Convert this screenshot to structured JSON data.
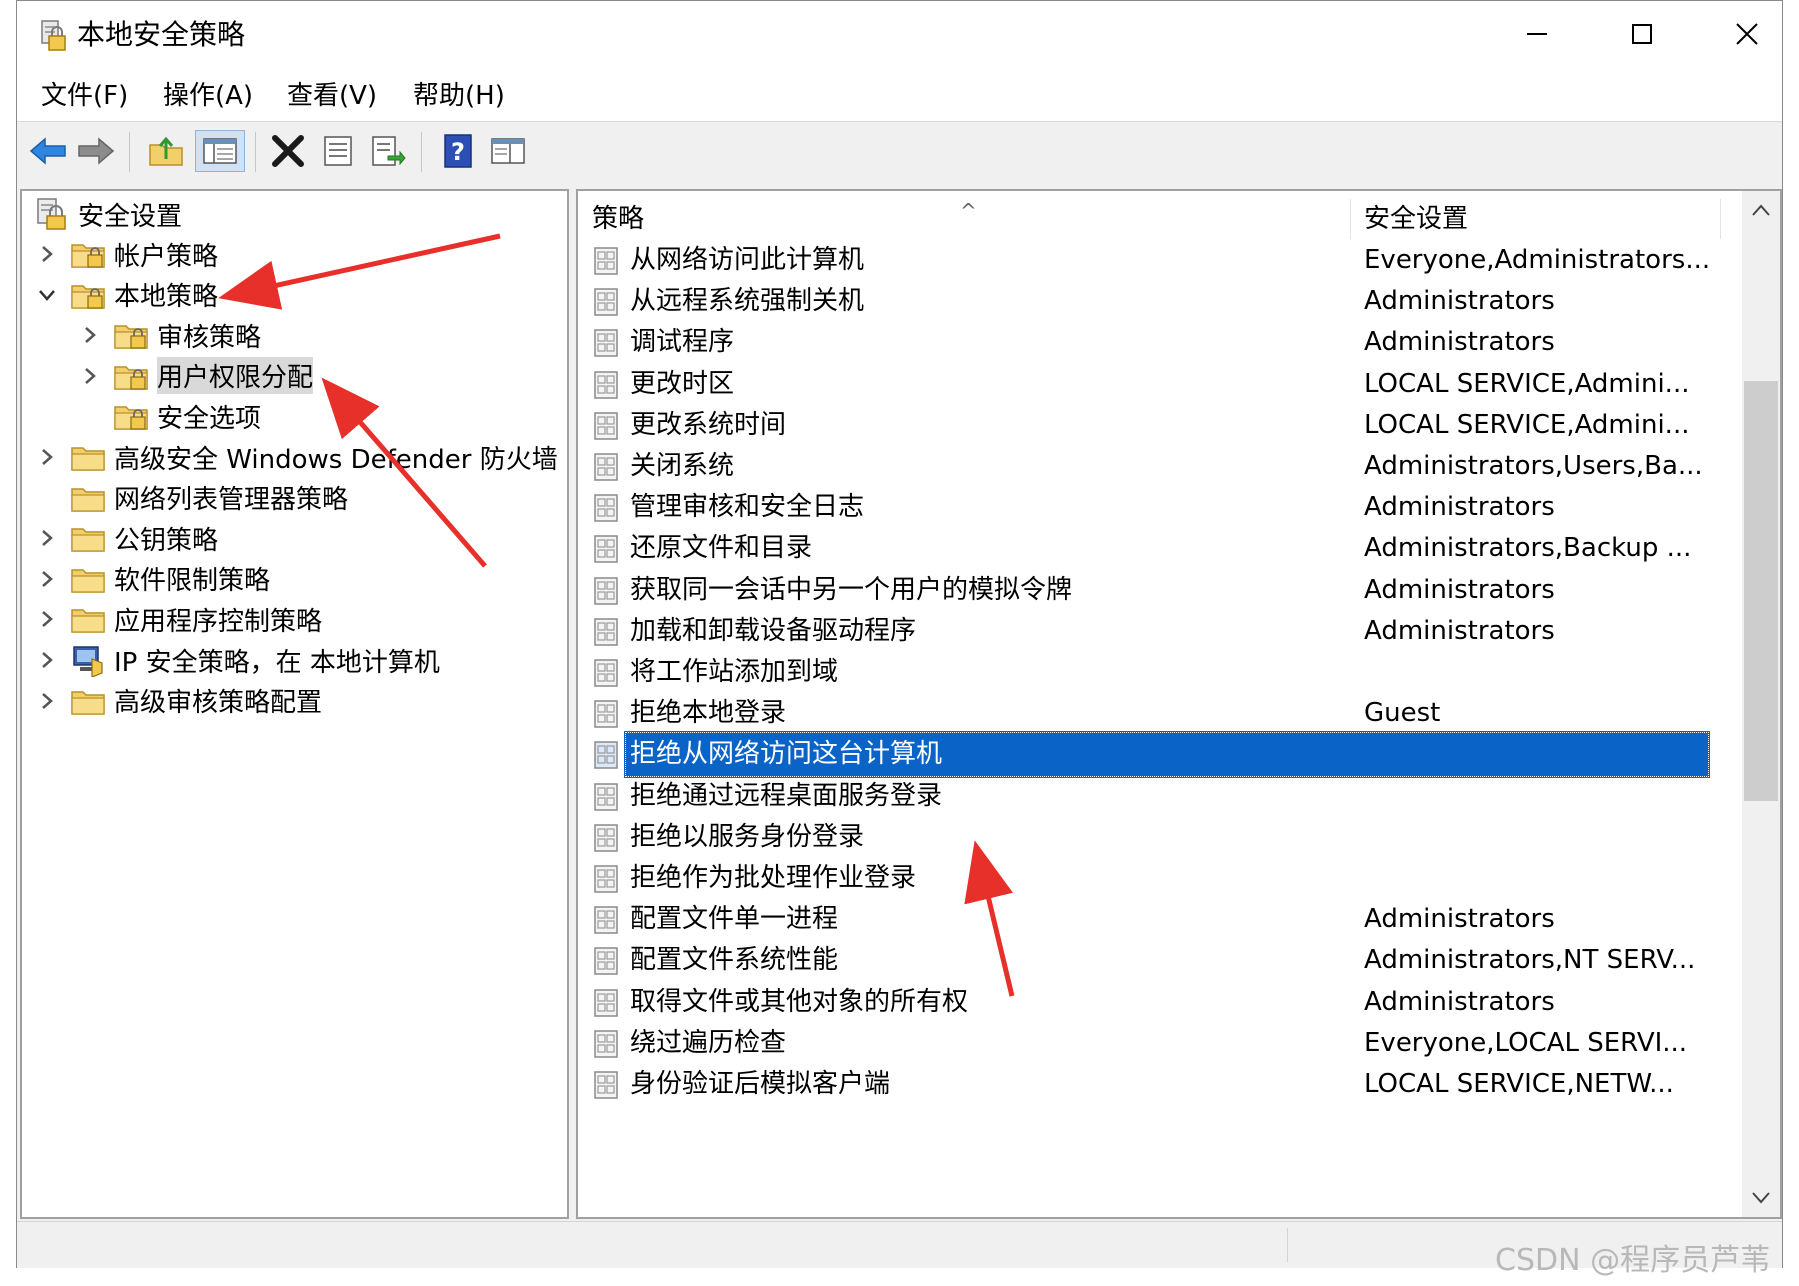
{
  "window": {
    "title": "本地安全策略",
    "icon": "security-policy-icon",
    "controls": [
      "minimize-icon",
      "maximize-icon",
      "close-icon"
    ]
  },
  "menu": {
    "file": "文件(F)",
    "action": "操作(A)",
    "view": "查看(V)",
    "help": "帮助(H)"
  },
  "toolbar": {
    "buttons": [
      "back-arrow-icon",
      "forward-arrow-icon",
      "up-folder-icon",
      "show-hide-tree-icon",
      "delete-icon",
      "properties-icon",
      "export-list-icon",
      "help-icon",
      "console-view-icon"
    ],
    "pressed": "show-hide-tree-icon"
  },
  "tree": {
    "root": "安全设置",
    "items": [
      {
        "label": "帐户策略",
        "level": 1,
        "expander": "collapsed"
      },
      {
        "label": "本地策略",
        "level": 1,
        "expander": "expanded"
      },
      {
        "label": "审核策略",
        "level": 2,
        "expander": "collapsed"
      },
      {
        "label": "用户权限分配",
        "level": 2,
        "expander": "collapsed",
        "selected": true
      },
      {
        "label": "安全选项",
        "level": 2,
        "expander": "none"
      },
      {
        "label": "高级安全 Windows Defender 防火墙",
        "level": 1,
        "expander": "collapsed"
      },
      {
        "label": "网络列表管理器策略",
        "level": 1,
        "expander": "none"
      },
      {
        "label": "公钥策略",
        "level": 1,
        "expander": "collapsed"
      },
      {
        "label": "软件限制策略",
        "level": 1,
        "expander": "collapsed"
      },
      {
        "label": "应用程序控制策略",
        "level": 1,
        "expander": "collapsed"
      },
      {
        "label": "IP 安全策略，在 本地计算机",
        "level": 1,
        "expander": "collapsed"
      },
      {
        "label": "高级审核策略配置",
        "level": 1,
        "expander": "collapsed"
      }
    ]
  },
  "list": {
    "columns": {
      "policy": "策略",
      "setting": "安全设置"
    },
    "sort_indicator": "^",
    "rows": [
      {
        "policy": "从网络访问此计算机",
        "setting": "Everyone,Administrators..."
      },
      {
        "policy": "从远程系统强制关机",
        "setting": "Administrators"
      },
      {
        "policy": "调试程序",
        "setting": "Administrators"
      },
      {
        "policy": "更改时区",
        "setting": "LOCAL SERVICE,Admini..."
      },
      {
        "policy": "更改系统时间",
        "setting": "LOCAL SERVICE,Admini..."
      },
      {
        "policy": "关闭系统",
        "setting": "Administrators,Users,Ba..."
      },
      {
        "policy": "管理审核和安全日志",
        "setting": "Administrators"
      },
      {
        "policy": "还原文件和目录",
        "setting": "Administrators,Backup ..."
      },
      {
        "policy": "获取同一会话中另一个用户的模拟令牌",
        "setting": "Administrators"
      },
      {
        "policy": "加载和卸载设备驱动程序",
        "setting": "Administrators"
      },
      {
        "policy": "将工作站添加到域",
        "setting": ""
      },
      {
        "policy": "拒绝本地登录",
        "setting": "Guest"
      },
      {
        "policy": "拒绝从网络访问这台计算机",
        "setting": "",
        "selected": true
      },
      {
        "policy": "拒绝通过远程桌面服务登录",
        "setting": ""
      },
      {
        "policy": "拒绝以服务身份登录",
        "setting": ""
      },
      {
        "policy": "拒绝作为批处理作业登录",
        "setting": ""
      },
      {
        "policy": "配置文件单一进程",
        "setting": "Administrators"
      },
      {
        "policy": "配置文件系统性能",
        "setting": "Administrators,NT SERV..."
      },
      {
        "policy": "取得文件或其他对象的所有权",
        "setting": "Administrators"
      },
      {
        "policy": "绕过遍历检查",
        "setting": "Everyone,LOCAL SERVI..."
      },
      {
        "policy": "身份验证后模拟客户端",
        "setting": "LOCAL SERVICE,NETW..."
      }
    ]
  },
  "watermark": "CSDN @程序员芦苇",
  "colors": {
    "selection": "#0a64c8",
    "annotation_arrow": "#e8302a",
    "folder": "#f2cf6b"
  }
}
